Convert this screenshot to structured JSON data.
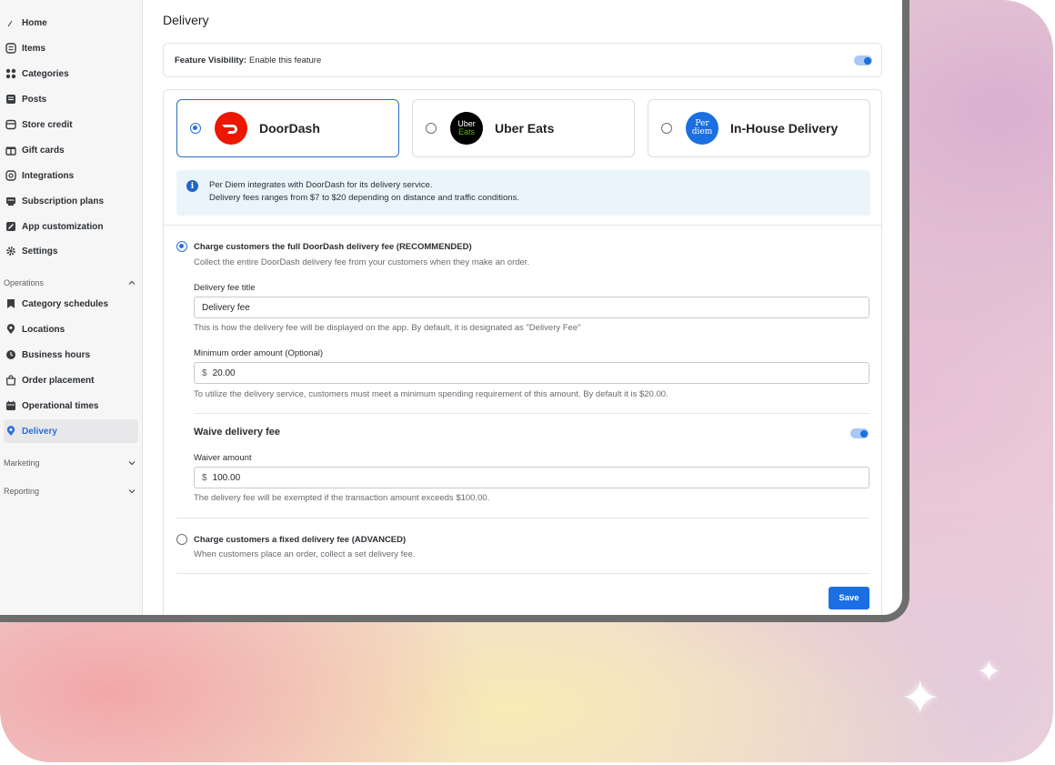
{
  "sidebar": {
    "items": [
      {
        "label": "Home",
        "icon": "home-icon"
      },
      {
        "label": "Items",
        "icon": "items-icon"
      },
      {
        "label": "Categories",
        "icon": "categories-icon"
      },
      {
        "label": "Posts",
        "icon": "posts-icon"
      },
      {
        "label": "Store credit",
        "icon": "store-credit-icon"
      },
      {
        "label": "Gift cards",
        "icon": "gift-card-icon"
      },
      {
        "label": "Integrations",
        "icon": "integrations-icon"
      },
      {
        "label": "Subscription plans",
        "icon": "subscription-icon"
      },
      {
        "label": "App customization",
        "icon": "app-customization-icon"
      },
      {
        "label": "Settings",
        "icon": "gear-icon"
      }
    ],
    "operations": {
      "label": "Operations",
      "items": [
        {
          "label": "Category schedules",
          "icon": "bookmark-icon"
        },
        {
          "label": "Locations",
          "icon": "location-pin-icon"
        },
        {
          "label": "Business hours",
          "icon": "clock-icon"
        },
        {
          "label": "Order placement",
          "icon": "bag-icon"
        },
        {
          "label": "Operational times",
          "icon": "calendar-icon"
        },
        {
          "label": "Delivery",
          "icon": "delivery-pin-icon"
        }
      ]
    },
    "marketing_label": "Marketing",
    "reporting_label": "Reporting"
  },
  "page": {
    "title": "Delivery",
    "visibility_label": "Feature Visibility:",
    "visibility_text": "Enable this feature",
    "visibility_on": true
  },
  "providers": [
    {
      "name": "DoorDash",
      "selected": true,
      "logo_text": "",
      "color": "#eb1700"
    },
    {
      "name": "Uber Eats",
      "selected": false,
      "logo_text": "Uber",
      "logo_text2": "Eats",
      "color": "#000000"
    },
    {
      "name": "In-House Delivery",
      "selected": false,
      "logo_text": "Per",
      "logo_text2": "diem",
      "color": "#1a6fe2"
    }
  ],
  "info": {
    "line1": "Per Diem integrates with DoorDash for its delivery service.",
    "line2": "Delivery fees ranges from $7 to $20 depending on distance and traffic conditions."
  },
  "option_full": {
    "title": "Charge customers the full DoorDash delivery fee (RECOMMENDED)",
    "desc": "Collect the entire DoorDash delivery fee from your customers when they make an order.",
    "selected": true
  },
  "fee_title": {
    "label": "Delivery fee title",
    "value": "Delivery fee",
    "help": "This is how the delivery fee will be displayed on the app. By default, it is designated as \"Delivery Fee\""
  },
  "min_order": {
    "label": "Minimum order amount (Optional)",
    "currency": "$",
    "value": "20.00",
    "help": "To utilize the delivery service, customers must meet a minimum spending requirement of this amount. By default it is $20.00."
  },
  "waive": {
    "title": "Waive delivery fee",
    "enabled": true,
    "label": "Waiver amount",
    "currency": "$",
    "value": "100.00",
    "help": "The delivery fee will be exempted if the transaction amount exceeds $100.00."
  },
  "option_fixed": {
    "title": "Charge customers a fixed delivery fee (ADVANCED)",
    "desc": "When customers place an order, collect a set delivery fee.",
    "selected": false
  },
  "save_label": "Save",
  "colors": {
    "accent": "#1a6fe2",
    "toggle_track": "#a9c8f3",
    "info_bg": "#eaf5fb",
    "doordash_red": "#eb1700"
  }
}
